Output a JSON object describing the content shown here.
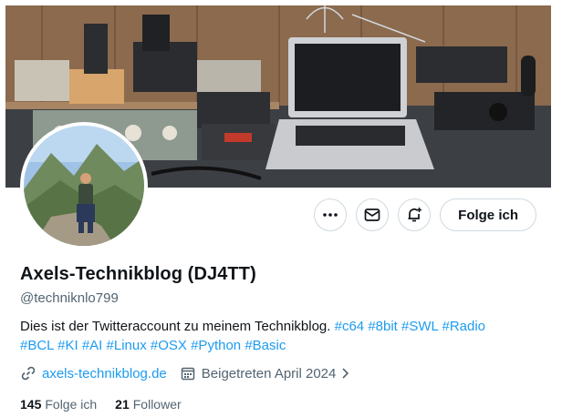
{
  "profile": {
    "display_name": "Axels-Technikblog (DJ4TT)",
    "handle": "@techniknlo799",
    "bio_text": "Dies ist der Twitteraccount zu meinem Technikblog.",
    "hashtags": [
      "#c64",
      "#8bit",
      "#SWL",
      "#Radio",
      "#BCL",
      "#KI",
      "#AI",
      "#Linux",
      "#OSX",
      "#Python",
      "#Basic"
    ],
    "website": "axels-technikblog.de",
    "joined": "Beigetreten April 2024"
  },
  "actions": {
    "follow_label": "Folge ich",
    "more_icon": "more-icon",
    "message_icon": "mail-icon",
    "notify_icon": "bell-icon"
  },
  "stats": {
    "following_count": "145",
    "following_label": "Folge ich",
    "followers_count": "21",
    "followers_label": "Follower"
  },
  "colors": {
    "accent": "#1d9bf0",
    "text": "#0f1419",
    "muted": "#536471",
    "border": "#cfd9de"
  }
}
